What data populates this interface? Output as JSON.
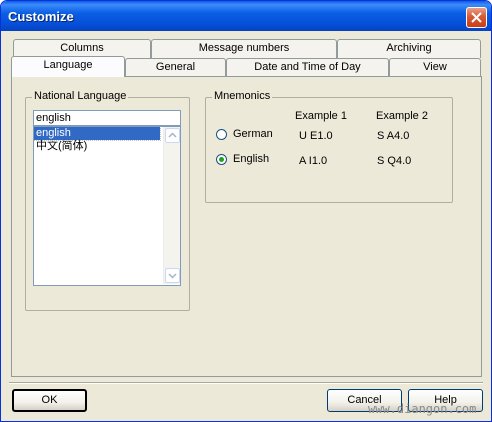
{
  "window": {
    "title": "Customize"
  },
  "tabs": {
    "row_back": [
      "Columns",
      "Message numbers",
      "Archiving"
    ],
    "row_front": [
      "Language",
      "General",
      "Date and Time of Day",
      "View"
    ],
    "active": "Language"
  },
  "national_language": {
    "group_label": "National Language",
    "current_value": "english",
    "options": [
      "english",
      "中文(简体)"
    ],
    "selected": "english"
  },
  "mnemonics": {
    "group_label": "Mnemonics",
    "headers": [
      "Example 1",
      "Example 2"
    ],
    "options": [
      {
        "label": "German",
        "example1": "U E1.0",
        "example2": "S A4.0",
        "checked": false
      },
      {
        "label": "English",
        "example1": "A I1.0",
        "example2": "S Q4.0",
        "checked": true
      }
    ]
  },
  "buttons": {
    "ok": "OK",
    "cancel": "Cancel",
    "help": "Help"
  },
  "watermark": "www.diangon.com"
}
